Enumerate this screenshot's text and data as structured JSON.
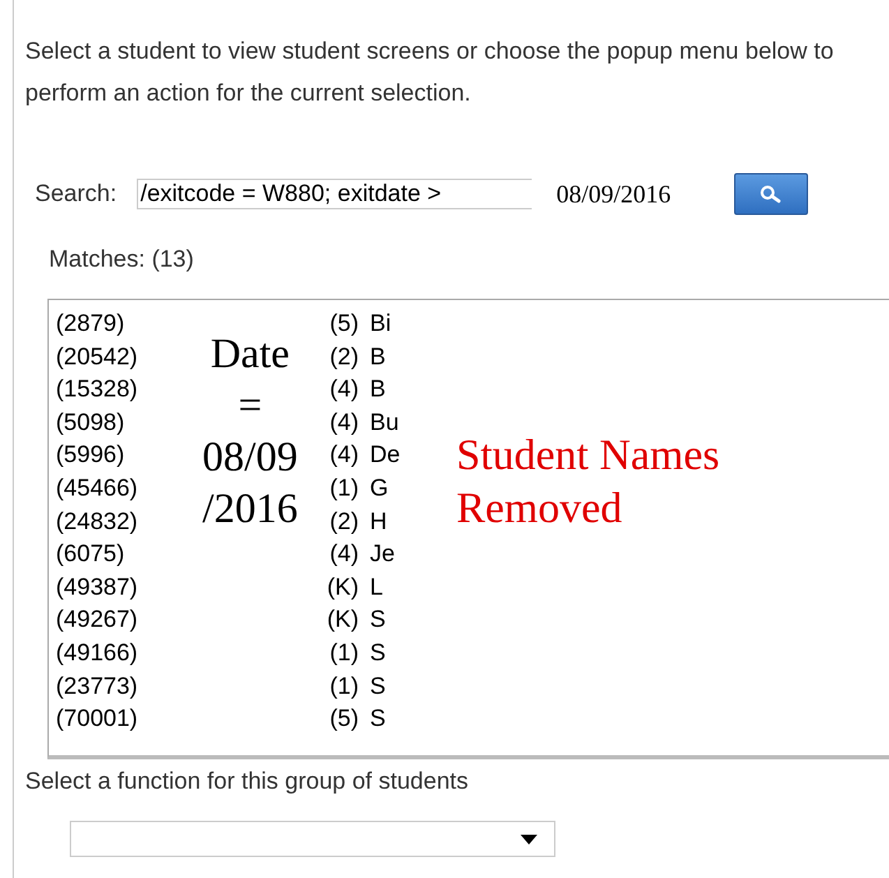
{
  "intro": "Select a student to view student screens or choose the popup menu below to perform an action for the current selection.",
  "search": {
    "label": "Search:",
    "value": "/exitcode = W880; exitdate > ",
    "date_note": "08/09/2016"
  },
  "matches": "Matches: (13)",
  "students": [
    {
      "id": "(2879)",
      "grade": "(5)",
      "name": "Bi"
    },
    {
      "id": "(20542)",
      "grade": "(2)",
      "name": "B"
    },
    {
      "id": "(15328)",
      "grade": "(4)",
      "name": "B"
    },
    {
      "id": "(5098)",
      "grade": "(4)",
      "name": "Bu"
    },
    {
      "id": "(5996)",
      "grade": "(4)",
      "name": "De"
    },
    {
      "id": "(45466)",
      "grade": "(1)",
      "name": "G"
    },
    {
      "id": "(24832)",
      "grade": "(2)",
      "name": "H"
    },
    {
      "id": "(6075)",
      "grade": "(4)",
      "name": "Je"
    },
    {
      "id": "(49387)",
      "grade": "(K)",
      "name": "L"
    },
    {
      "id": "(49267)",
      "grade": "(K)",
      "name": "S"
    },
    {
      "id": "(49166)",
      "grade": "(1)",
      "name": "S"
    },
    {
      "id": "(23773)",
      "grade": "(1)",
      "name": "S"
    },
    {
      "id": "(70001)",
      "grade": "(5)",
      "name": "S"
    }
  ],
  "date_annotation": [
    "Date",
    "=",
    "08/09",
    "/2016"
  ],
  "names_annotation": [
    "Student Names",
    "Removed"
  ],
  "function_label": "Select a function for this group of students"
}
